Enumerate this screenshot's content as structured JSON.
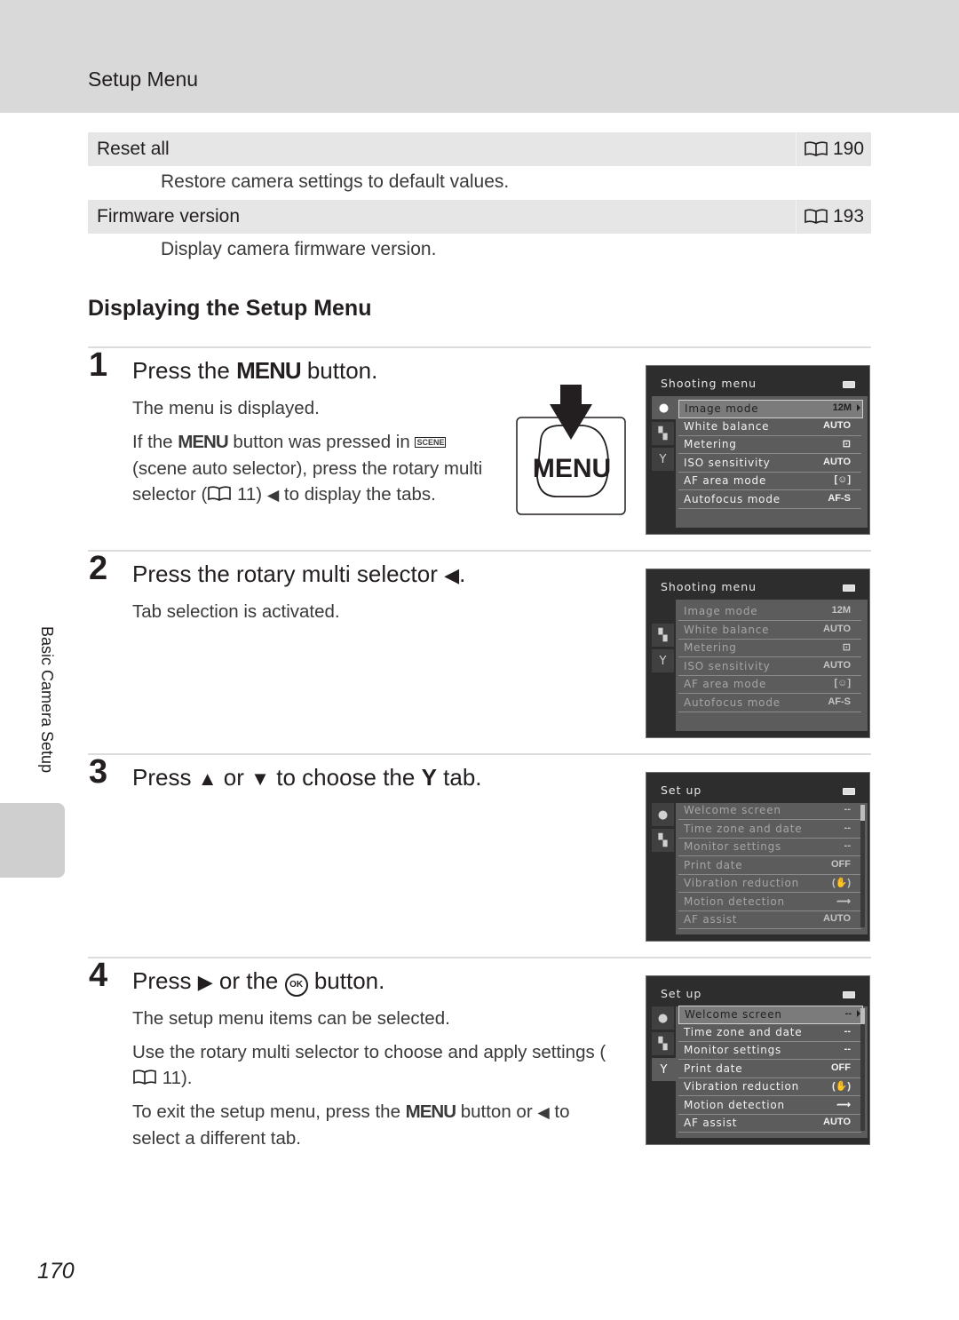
{
  "header": {
    "title": "Setup Menu"
  },
  "reference_table": [
    {
      "label": "Reset all",
      "page": "190",
      "description": "Restore camera settings to default values."
    },
    {
      "label": "Firmware version",
      "page": "193",
      "description": "Display camera firmware version."
    }
  ],
  "section_title": "Displaying the Setup Menu",
  "steps": [
    {
      "number": "1",
      "title_pre": "Press the ",
      "title_key": "MENU",
      "title_post": " button.",
      "p1": "The menu is displayed.",
      "p2_a": "If the ",
      "p2_key": "MENU",
      "p2_b": " button was pressed in ",
      "p2_icon": "SCENE",
      "p2_c": " (scene auto selector), press the rotary multi selector (",
      "p2_ref": "11",
      "p2_d": ") ",
      "p2_e": " to display the tabs.",
      "illustration_label": "MENU"
    },
    {
      "number": "2",
      "title_pre": "Press the rotary multi selector ",
      "title_post": ".",
      "p1": "Tab selection is activated."
    },
    {
      "number": "3",
      "title_a": "Press ",
      "title_b": " or ",
      "title_c": " to choose the ",
      "title_d": " tab."
    },
    {
      "number": "4",
      "title_a": "Press ",
      "title_b": " or the ",
      "title_ok": "OK",
      "title_c": " button.",
      "p1": "The setup menu items can be selected.",
      "p2_a": "Use the rotary multi selector to choose and apply settings (",
      "p2_ref": "11",
      "p2_b": ").",
      "p3_a": "To exit the setup menu, press the ",
      "p3_key": "MENU",
      "p3_b": " button or ",
      "p3_c": " to select a different tab."
    }
  ],
  "screens": [
    {
      "title": "Shooting menu",
      "items": [
        {
          "name": "Image mode",
          "value": "12M"
        },
        {
          "name": "White balance",
          "value": "AUTO"
        },
        {
          "name": "Metering",
          "value": "⊡"
        },
        {
          "name": "ISO sensitivity",
          "value": "AUTO"
        },
        {
          "name": "AF area mode",
          "value": "[☺]"
        },
        {
          "name": "Autofocus mode",
          "value": "AF-S"
        }
      ]
    },
    {
      "title": "Shooting menu",
      "items": [
        {
          "name": "Image mode",
          "value": "12M"
        },
        {
          "name": "White balance",
          "value": "AUTO"
        },
        {
          "name": "Metering",
          "value": "⊡"
        },
        {
          "name": "ISO sensitivity",
          "value": "AUTO"
        },
        {
          "name": "AF area mode",
          "value": "[☺]"
        },
        {
          "name": "Autofocus mode",
          "value": "AF-S"
        }
      ]
    },
    {
      "title": "Set up",
      "items": [
        {
          "name": "Welcome screen",
          "value": "--"
        },
        {
          "name": "Time zone and date",
          "value": "--"
        },
        {
          "name": "Monitor settings",
          "value": "--"
        },
        {
          "name": "Print date",
          "value": "OFF"
        },
        {
          "name": "Vibration reduction",
          "value": "(✋)"
        },
        {
          "name": "Motion detection",
          "value": "⟿"
        },
        {
          "name": "AF assist",
          "value": "AUTO"
        }
      ]
    },
    {
      "title": "Set up",
      "items": [
        {
          "name": "Welcome screen",
          "value": "--"
        },
        {
          "name": "Time zone and date",
          "value": "--"
        },
        {
          "name": "Monitor settings",
          "value": "--"
        },
        {
          "name": "Print date",
          "value": "OFF"
        },
        {
          "name": "Vibration reduction",
          "value": "(✋)"
        },
        {
          "name": "Motion detection",
          "value": "⟿"
        },
        {
          "name": "AF assist",
          "value": "AUTO"
        }
      ]
    }
  ],
  "icons": {
    "left": "◀",
    "right": "▶",
    "up": "▲",
    "down": "▼",
    "camera": "●",
    "movie": "▚",
    "wrench": "Y"
  },
  "side_tab": {
    "label": "Basic Camera Setup"
  },
  "page_number": "170"
}
